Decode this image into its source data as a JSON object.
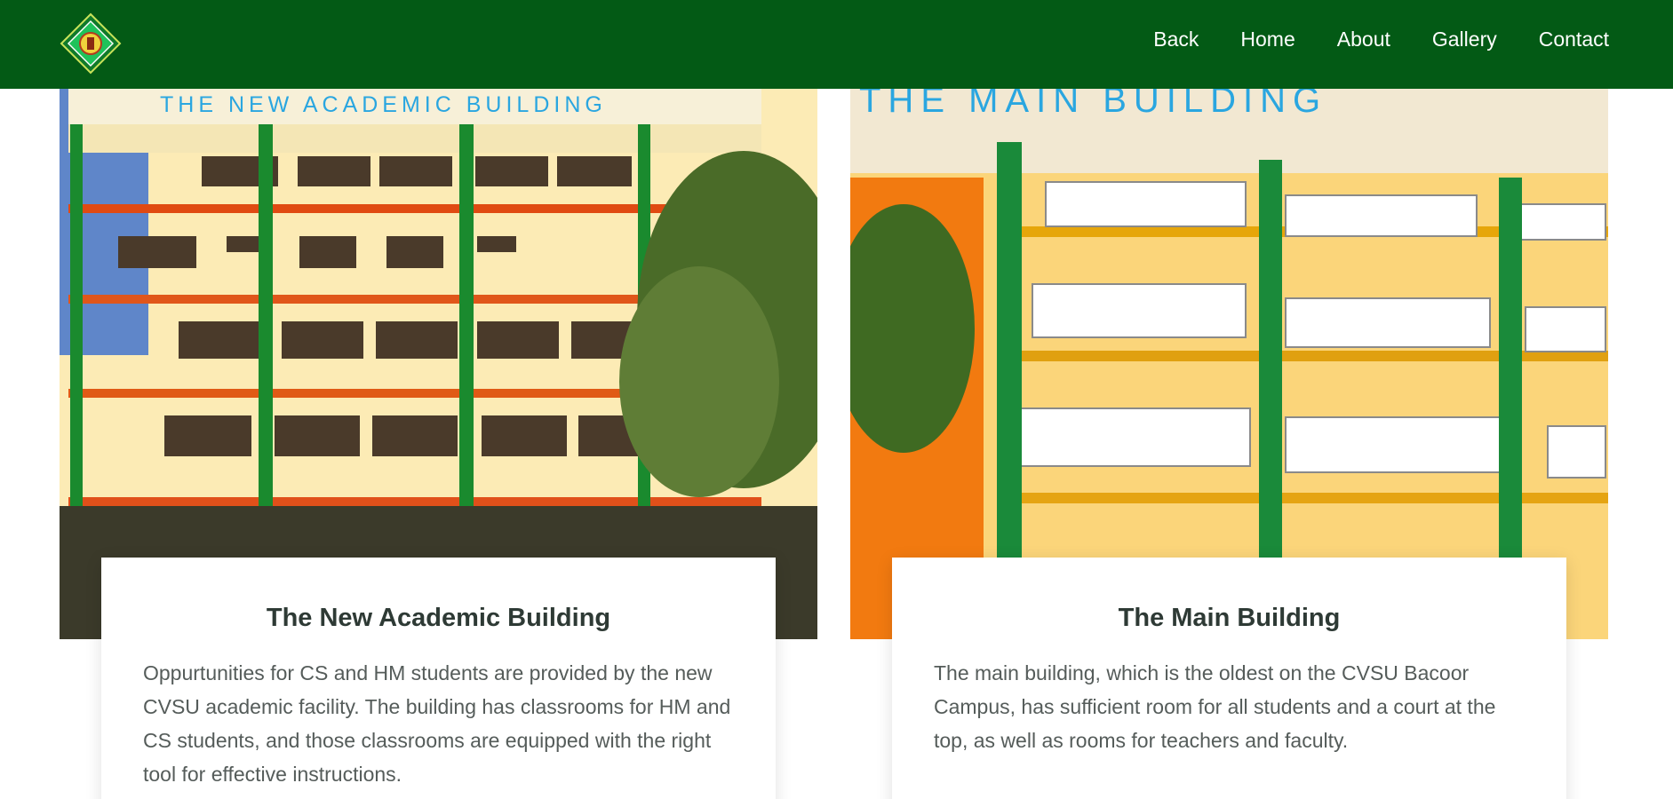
{
  "brand": {
    "logo_icon": "cvsu-seal-icon",
    "nav_color": "#035a15"
  },
  "nav": {
    "items": [
      {
        "label": "Back"
      },
      {
        "label": "Home"
      },
      {
        "label": "About"
      },
      {
        "label": "Gallery"
      },
      {
        "label": "Contact"
      }
    ]
  },
  "cards": [
    {
      "sign": "THE NEW ACADEMIC BUILDING",
      "title": "The New Academic Building",
      "text": "Oppurtunities for CS and HM students are provided by the new CVSU academic facility. The building has classrooms for HM and CS students, and those classrooms are equipped with the right tool for effective instructions."
    },
    {
      "sign": "THE MAIN BUILDING",
      "title": "The Main Building",
      "text": "The main building, which is the oldest on the CVSU Bacoor Campus, has sufficient room for all students and a court at the top, as well as rooms for teachers and faculty."
    }
  ]
}
